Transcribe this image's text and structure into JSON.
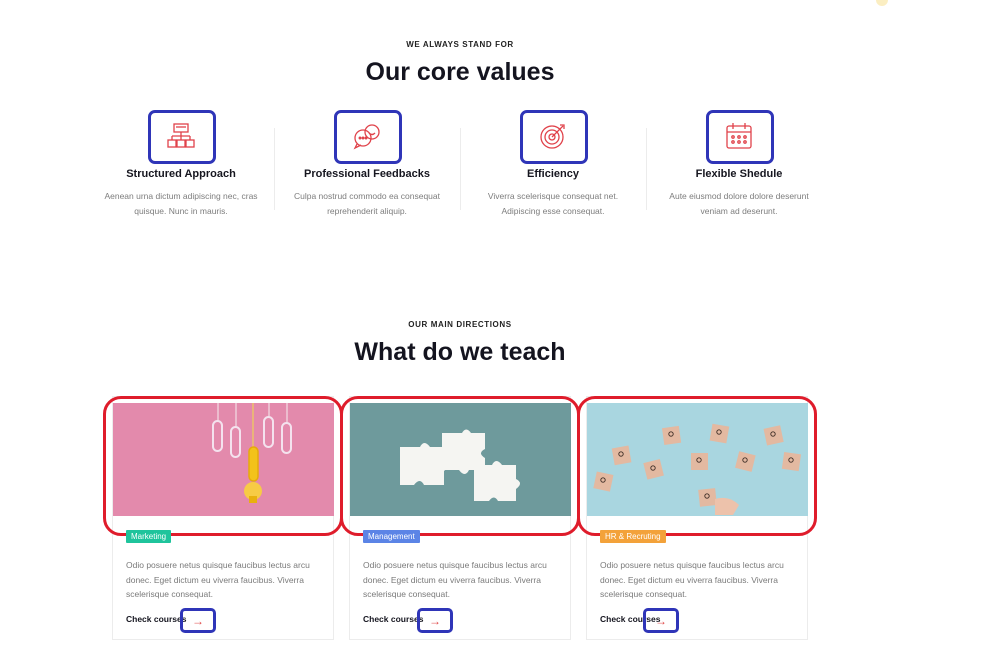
{
  "core_values": {
    "eyebrow": "WE ALWAYS STAND FOR",
    "title": "Our core values",
    "items": [
      {
        "title": "Structured Approach",
        "desc": "Aenean urna dictum adipiscing nec, cras quisque. Nunc in mauris.",
        "icon": "sitemap-icon"
      },
      {
        "title": "Professional Feedbacks",
        "desc": "Culpa nostrud commodo ea consequat reprehenderit aliquip.",
        "icon": "chat-bubbles-icon"
      },
      {
        "title": "Efficiency",
        "desc": "Viverra scelerisque consequat net. Adipiscing esse consequat.",
        "icon": "target-icon"
      },
      {
        "title": "Flexible Shedule",
        "desc": "Aute eiusmod dolore dolore deserunt veniam ad deserunt.",
        "icon": "calendar-icon"
      }
    ],
    "icon_color": "#e0424a",
    "highlight_color": "#2f35b8"
  },
  "teach": {
    "eyebrow": "OUR MAIN DIRECTIONS",
    "title": "What do we teach",
    "highlight_color": "#df1c2b",
    "cards": [
      {
        "badge": "Marketing",
        "badge_color": "#1fc49c",
        "text": "Odio posuere netus quisque faucibus lectus arcu donec. Eget dictum eu viverra faucibus. Viverra scelerisque consequat.",
        "link": "Check courses",
        "arrow": "→",
        "image": "paperclips-lightbulb-image"
      },
      {
        "badge": "Management",
        "badge_color": "#5b84e6",
        "text": "Odio posuere netus quisque faucibus lectus arcu donec. Eget dictum eu viverra faucibus. Viverra scelerisque consequat.",
        "link": "Check courses",
        "arrow": "→",
        "image": "puzzle-pieces-image"
      },
      {
        "badge": "HR & Recruting",
        "badge_color": "#f3a23a",
        "text": "Odio posuere netus quisque faucibus lectus arcu donec. Eget dictum eu viverra faucibus. Viverra scelerisque consequat.",
        "link": "Check courses",
        "arrow": "→",
        "image": "people-blocks-image"
      }
    ]
  }
}
